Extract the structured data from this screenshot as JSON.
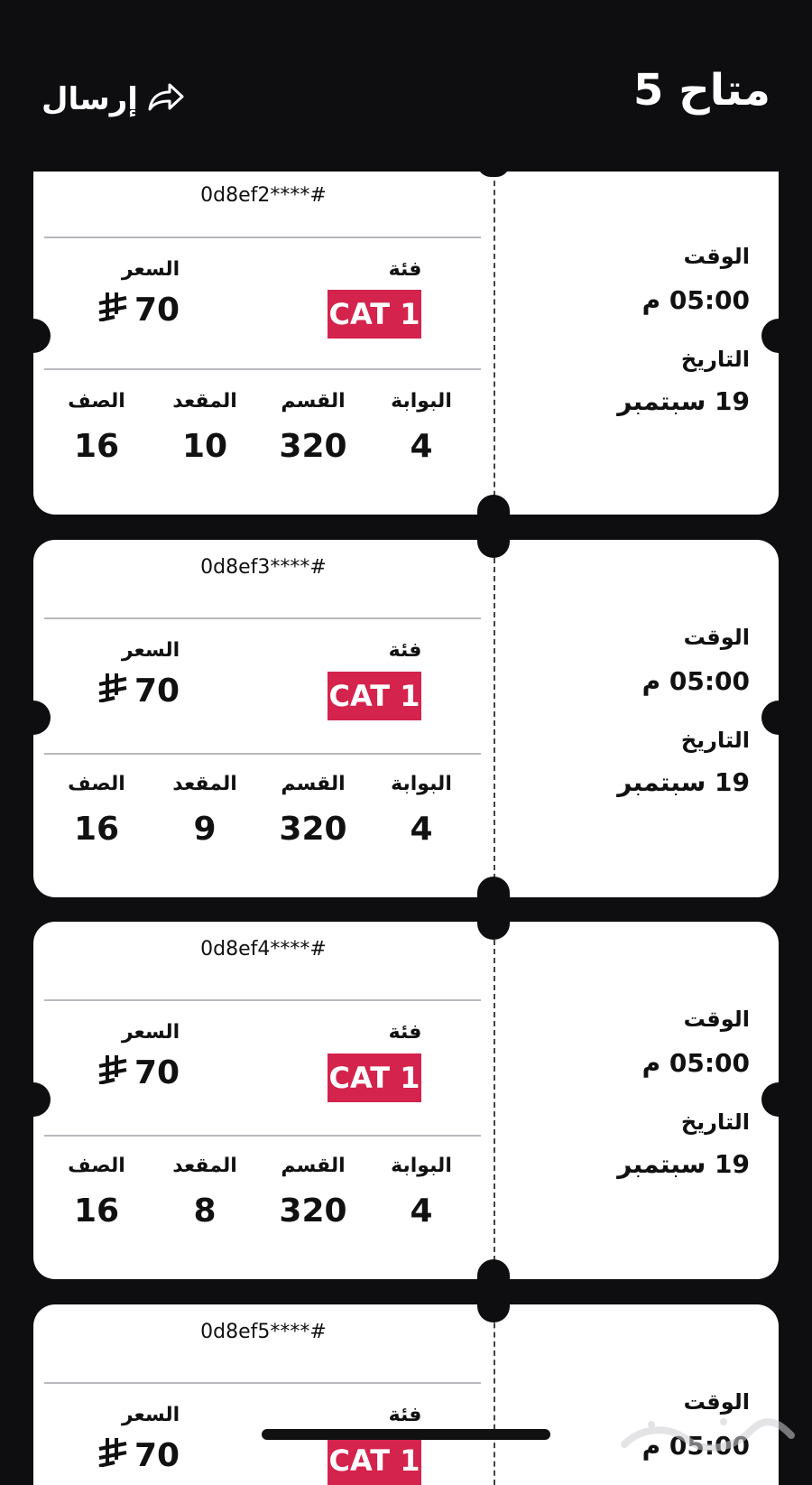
{
  "header": {
    "title": "متاح 5",
    "send_label": "إرسال"
  },
  "labels": {
    "time": "الوقت",
    "date": "التاريخ",
    "category": "فئة",
    "price": "السعر",
    "gate": "البوابة",
    "section": "القسم",
    "seat": "المقعد",
    "row": "الصف"
  },
  "tickets": [
    {
      "id": "0d8ef2****#",
      "category": "CAT 1",
      "price": "70",
      "gate": "4",
      "section": "320",
      "seat": "10",
      "row": "16",
      "time": "05:00 م",
      "date": "19 سبتمبر"
    },
    {
      "id": "0d8ef3****#",
      "category": "CAT 1",
      "price": "70",
      "gate": "4",
      "section": "320",
      "seat": "9",
      "row": "16",
      "time": "05:00 م",
      "date": "19 سبتمبر"
    },
    {
      "id": "0d8ef4****#",
      "category": "CAT 1",
      "price": "70",
      "gate": "4",
      "section": "320",
      "seat": "8",
      "row": "16",
      "time": "05:00 م",
      "date": "19 سبتمبر"
    },
    {
      "id": "0d8ef5****#",
      "category": "CAT 1",
      "price": "70",
      "gate": "",
      "section": "",
      "seat": "",
      "row": "",
      "time": "05:00 م",
      "date": ""
    }
  ],
  "colors": {
    "accent": "#d4234c",
    "background": "#0e0e10",
    "card": "#ffffff"
  },
  "icons": {
    "send": "share-arrow-icon",
    "currency": "riyal-icon"
  }
}
